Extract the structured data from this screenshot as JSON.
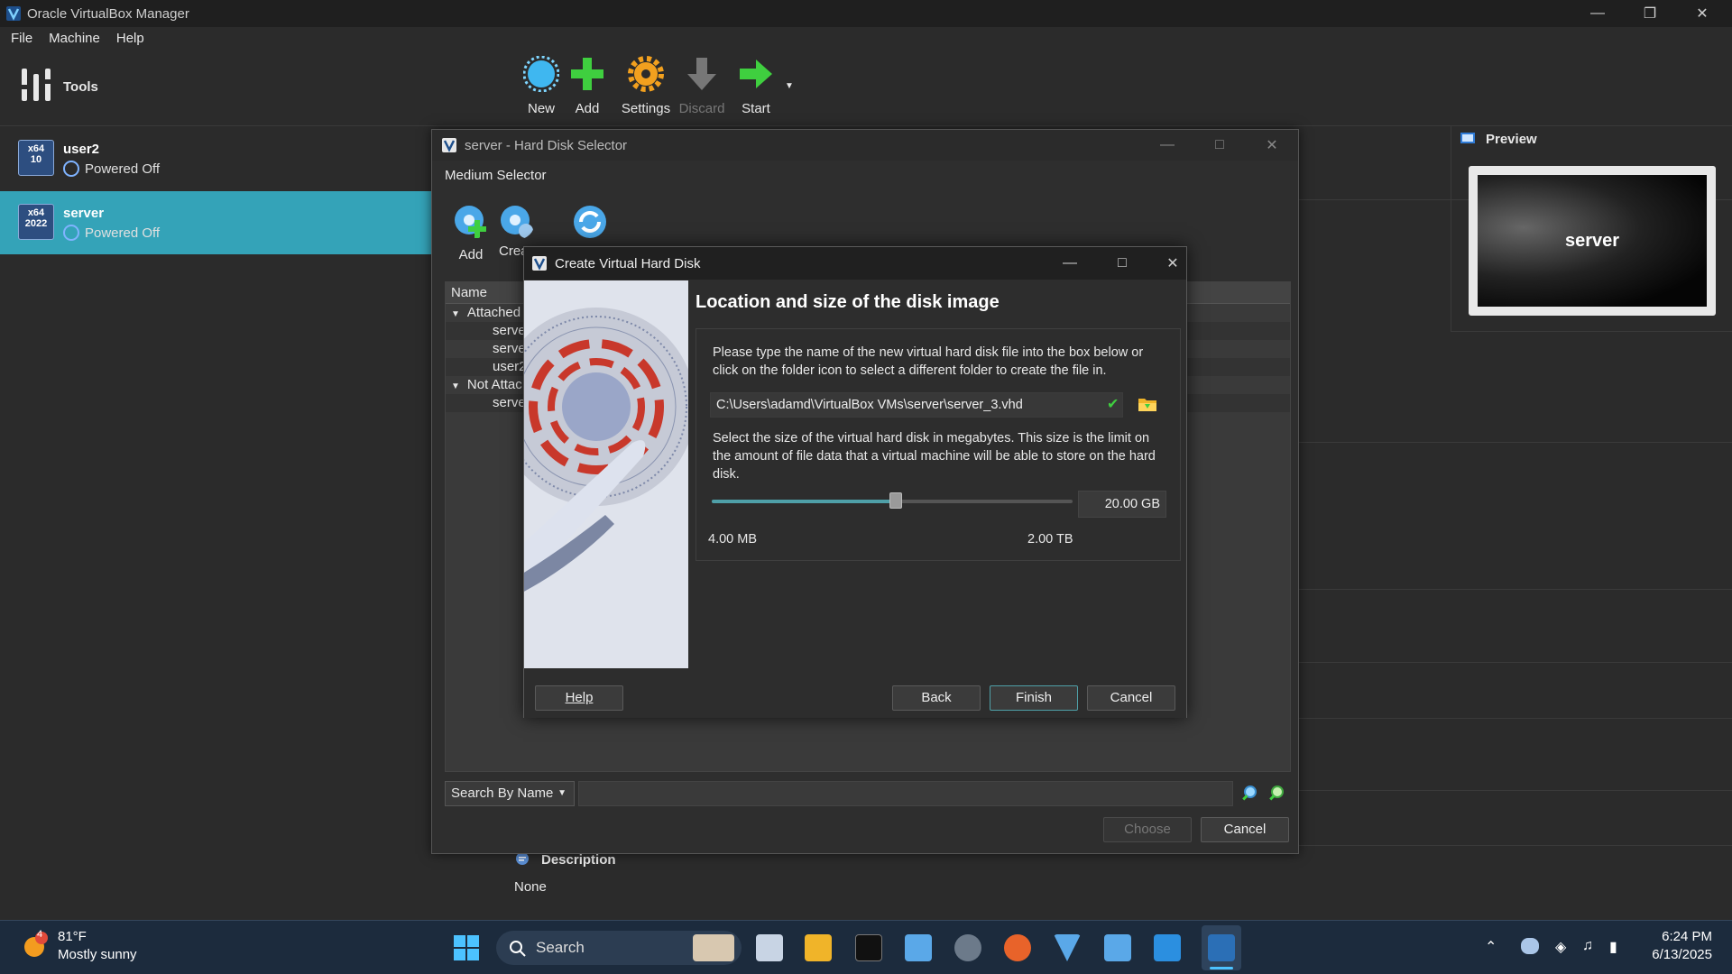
{
  "window": {
    "title": "Oracle VirtualBox Manager"
  },
  "menu": [
    "File",
    "Machine",
    "Help"
  ],
  "tools": {
    "label": "Tools"
  },
  "vms": [
    {
      "name": "user2",
      "os_badge": "x64",
      "os_ver": "10",
      "state": "Powered Off"
    },
    {
      "name": "server",
      "os_badge": "x64",
      "os_ver": "2022",
      "state": "Powered Off"
    }
  ],
  "toolbar": {
    "new": "New",
    "add": "Add",
    "settings": "Settings",
    "discard": "Discard",
    "start": "Start"
  },
  "preview": {
    "title": "Preview",
    "screen_text": "server"
  },
  "description": {
    "title": "Description",
    "value": "None"
  },
  "hds": {
    "title": "server - Hard Disk Selector",
    "subtitle": "Medium Selector",
    "tool_add": "Add",
    "tool_create": "Crea",
    "column_name": "Name",
    "tree": [
      {
        "label": "Attached",
        "indent": 0,
        "group": true
      },
      {
        "label": "serve",
        "indent": 1
      },
      {
        "label": "serve",
        "indent": 1
      },
      {
        "label": "user2",
        "indent": 1
      },
      {
        "label": "Not Attac",
        "indent": 0,
        "group": true
      },
      {
        "label": "serve",
        "indent": 1
      }
    ],
    "search_mode": "Search By Name",
    "choose": "Choose",
    "cancel": "Cancel"
  },
  "cvhd": {
    "title": "Create Virtual Hard Disk",
    "heading": "Location and size of the disk image",
    "para1": "Please type the name of the new virtual hard disk file into the box below or click on the folder icon to select a different folder to create the file in.",
    "path": "C:\\Users\\adamd\\VirtualBox VMs\\server\\server_3.vhd",
    "para2": "Select the size of the virtual hard disk in megabytes. This size is the limit on the amount of file data that a virtual machine will be able to store on the hard disk.",
    "size_value": "20.00 GB",
    "slider_fraction": 0.51,
    "min_label": "4.00 MB",
    "max_label": "2.00 TB",
    "help": "Help",
    "back": "Back",
    "finish": "Finish",
    "cancel": "Cancel"
  },
  "taskbar": {
    "weather_badge": "4",
    "temp": "81°F",
    "condition": "Mostly sunny",
    "search": "Search",
    "time": "6:24 PM",
    "date": "6/13/2025"
  },
  "colors": {
    "selected_vm": "#34a3b8",
    "accent": "#4fa0a8",
    "taskbar": "#1c2b3d"
  }
}
